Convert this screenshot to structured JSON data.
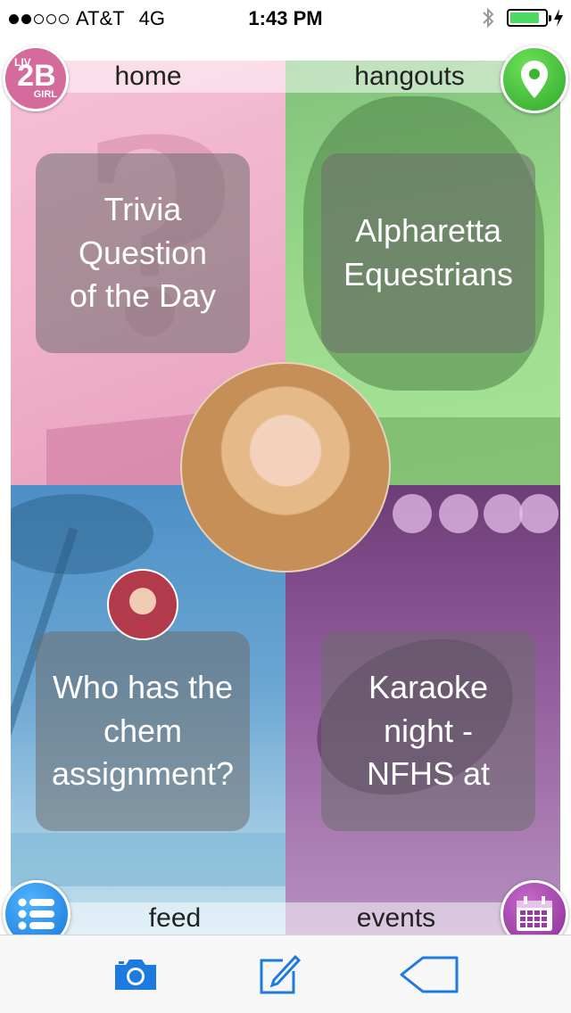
{
  "status_bar": {
    "carrier": "AT&T",
    "network": "4G",
    "time": "1:43 PM",
    "signal_bars_filled": 2,
    "signal_bars_total": 5,
    "battery_level": 0.85
  },
  "app": {
    "logo": {
      "text_top": "LIV",
      "text_main": "2B",
      "text_bottom": "GIRL"
    },
    "tiles": {
      "home": {
        "label": "home",
        "card_lines": [
          "Trivia",
          "Question",
          "of the Day"
        ]
      },
      "hangouts": {
        "label": "hangouts",
        "card_lines": [
          "Alpharetta",
          "Equestrians"
        ]
      },
      "feed": {
        "label": "feed",
        "card_lines": [
          "Who has the",
          "chem",
          "assignment?"
        ]
      },
      "events": {
        "label": "events",
        "card_lines": [
          "Karaoke",
          "night -",
          "NFHS at"
        ]
      }
    }
  },
  "toolbar": {
    "items": [
      "camera-icon",
      "compose-icon",
      "tag-icon"
    ]
  },
  "colors": {
    "home": "#f0b6cd",
    "hangouts": "#9bd98c",
    "feed": "#5b9acb",
    "events": "#8a5794",
    "accent_blue": "#1d7be0",
    "pin_green": "#3cb532",
    "calendar_purple": "#9a3aa4",
    "battery_green": "#4cd964"
  }
}
